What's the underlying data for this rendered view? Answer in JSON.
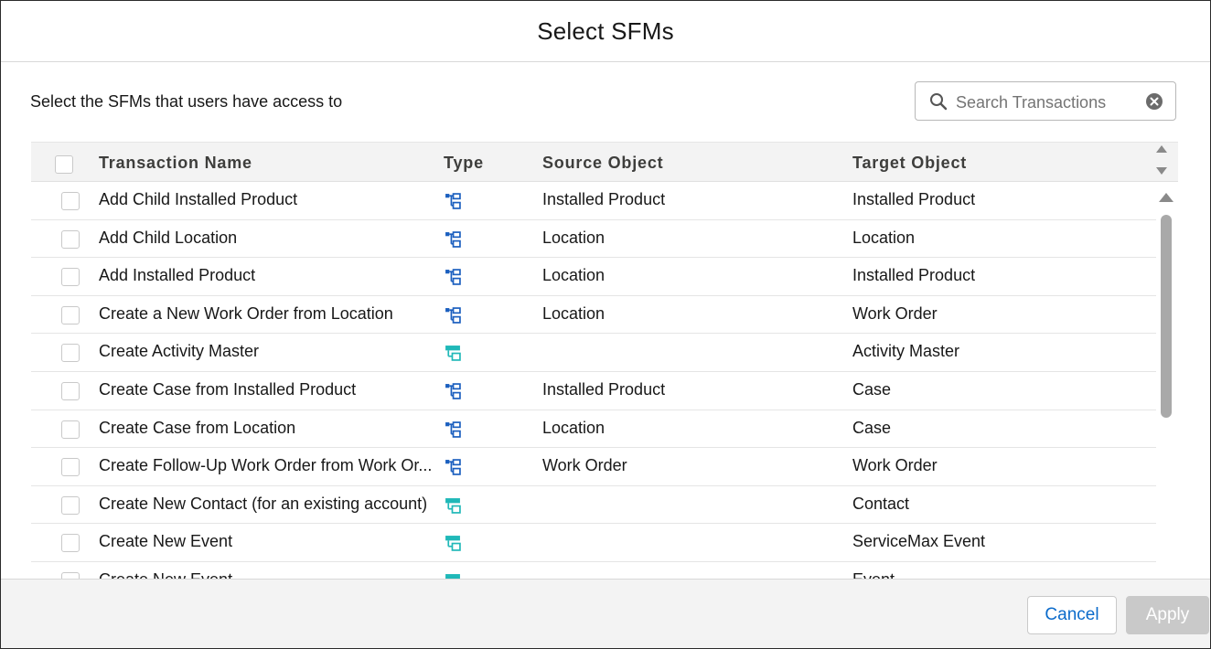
{
  "modal": {
    "title": "Select SFMs",
    "subtitle": "Select the SFMs that users have access to"
  },
  "search": {
    "placeholder": "Search Transactions",
    "value": ""
  },
  "table": {
    "columns": {
      "name": "Transaction Name",
      "type": "Type",
      "source": "Source Object",
      "target": "Target Object"
    },
    "rows": [
      {
        "name": "Add Child Installed Product",
        "type_icon": "hierarchy-icon",
        "source": "Installed Product",
        "target": "Installed Product"
      },
      {
        "name": "Add Child Location",
        "type_icon": "hierarchy-icon",
        "source": "Location",
        "target": "Location"
      },
      {
        "name": "Add Installed Product",
        "type_icon": "hierarchy-icon",
        "source": "Location",
        "target": "Installed Product"
      },
      {
        "name": "Create a New Work Order from Location",
        "type_icon": "hierarchy-icon",
        "source": "Location",
        "target": "Work Order"
      },
      {
        "name": "Create Activity Master",
        "type_icon": "standalone-icon",
        "source": "",
        "target": "Activity Master"
      },
      {
        "name": "Create Case from Installed Product",
        "type_icon": "hierarchy-icon",
        "source": "Installed Product",
        "target": "Case"
      },
      {
        "name": "Create Case from Location",
        "type_icon": "hierarchy-icon",
        "source": "Location",
        "target": "Case"
      },
      {
        "name": "Create Follow-Up Work Order from Work Or...",
        "type_icon": "hierarchy-icon",
        "source": "Work Order",
        "target": "Work Order"
      },
      {
        "name": "Create New Contact (for an existing account)",
        "type_icon": "standalone-icon",
        "source": "",
        "target": "Contact"
      },
      {
        "name": "Create New Event",
        "type_icon": "standalone-icon",
        "source": "",
        "target": "ServiceMax Event"
      },
      {
        "name": "Create New Event",
        "type_icon": "standalone-icon",
        "source": "",
        "target": "Event"
      }
    ]
  },
  "footer": {
    "cancel_label": "Cancel",
    "apply_label": "Apply"
  },
  "colors": {
    "hierarchy_icon": "#1b5fbf",
    "standalone_icon": "#20b8b8",
    "cancel_text": "#0b6bcb",
    "apply_disabled_bg": "#c9c9c9"
  }
}
